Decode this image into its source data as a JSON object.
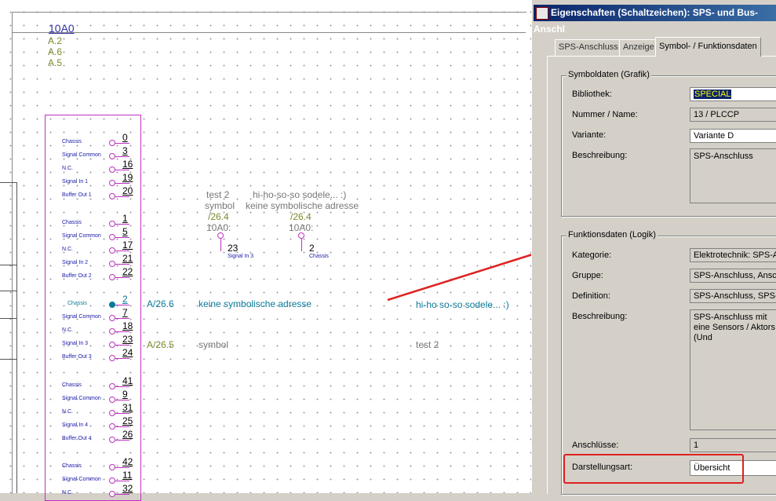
{
  "canvas": {
    "header": {
      "code": "10A0",
      "refs": [
        "A.2",
        "A.6",
        "A.5"
      ]
    },
    "plc": {
      "groups": [
        {
          "rows": [
            {
              "label": "Chassis",
              "num": "0"
            },
            {
              "label": "Signal Common",
              "num": "3"
            },
            {
              "label": "N.C.",
              "num": "16"
            },
            {
              "label": "Signal In 1",
              "num": "19"
            },
            {
              "label": "Buffer Out 1",
              "num": "20"
            }
          ]
        },
        {
          "rows": [
            {
              "label": "Chassis",
              "num": "1"
            },
            {
              "label": "Signal Common",
              "num": "5"
            },
            {
              "label": "N.C.",
              "num": "17"
            },
            {
              "label": "Signal In 2",
              "num": "21"
            },
            {
              "label": "Buffer Out 2",
              "num": "22"
            }
          ]
        },
        {
          "rows": [
            {
              "label": "Chassis",
              "num": "2"
            },
            {
              "label": "Signal Common",
              "num": "7"
            },
            {
              "label": "N.C.",
              "num": "18"
            },
            {
              "label": "Signal In 3",
              "num": "23"
            },
            {
              "label": "Buffer Out 3",
              "num": "24"
            }
          ]
        },
        {
          "rows": [
            {
              "label": "Chassis",
              "num": "41"
            },
            {
              "label": "Signal Common",
              "num": "9"
            },
            {
              "label": "N.C.",
              "num": "31"
            },
            {
              "label": "Signal In 4",
              "num": "25"
            },
            {
              "label": "Buffer Out 4",
              "num": "26"
            }
          ]
        },
        {
          "rows": [
            {
              "label": "Chassis",
              "num": "42"
            },
            {
              "label": "Signal Common",
              "num": "11"
            },
            {
              "label": "N.C.",
              "num": "32"
            }
          ]
        }
      ]
    },
    "sym1": {
      "l1": "test 2",
      "l2": "symbol",
      "ref": "/26.4",
      "dev": "10A0:",
      "num": "23",
      "sig": "Signal In 3"
    },
    "sym2": {
      "l1": "hi-ho-so-so sodele... :)",
      "l2": "keine symbolische adresse",
      "ref": "/26.4",
      "dev": "10A0:",
      "num": "2",
      "sig": "Chassis"
    },
    "row1": {
      "addr": "A/26.6",
      "desc": "keine symbolische adresse",
      "right": "hi-ho so-so sodele... :)"
    },
    "row2": {
      "addr": "A/26.5",
      "desc": "symbol",
      "right": "test 2"
    }
  },
  "dialog": {
    "title": "Eigenschaften (Schaltzeichen): SPS- und Bus-Anschl",
    "tabs": [
      "SPS-Anschluss",
      "Anzeige",
      "Symbol- / Funktionsdaten"
    ],
    "active_tab": "Symbol- / Funktionsdaten",
    "symbol_group": {
      "label": "Symboldaten (Grafik)",
      "bibliothek_label": "Bibliothek:",
      "bibliothek": "SPECIAL",
      "nummer_label": "Nummer / Name:",
      "nummer": "13 / PLCCP",
      "variante_label": "Variante:",
      "variante": "Variante D",
      "beschreibung_label": "Beschreibung:",
      "beschreibung": "SPS-Anschluss"
    },
    "function_group": {
      "label": "Funktionsdaten (Logik)",
      "kategorie_label": "Kategorie:",
      "kategorie": "Elektrotechnik: SPS-An",
      "gruppe_label": "Gruppe:",
      "gruppe": "SPS-Anschluss, Ansch",
      "definition_label": "Definition:",
      "definition": "SPS-Anschluss, SPS-A",
      "beschreibung_label": "Beschreibung:",
      "beschreibung": "SPS-Anschluss mit eine Sensors / Aktors (Und",
      "anschluesse_label": "Anschlüsse:",
      "anschluesse": "1",
      "darstellungsart_label": "Darstellungsart:",
      "darstellungsart": "Übersicht"
    },
    "highlight_color": "#e02020"
  }
}
